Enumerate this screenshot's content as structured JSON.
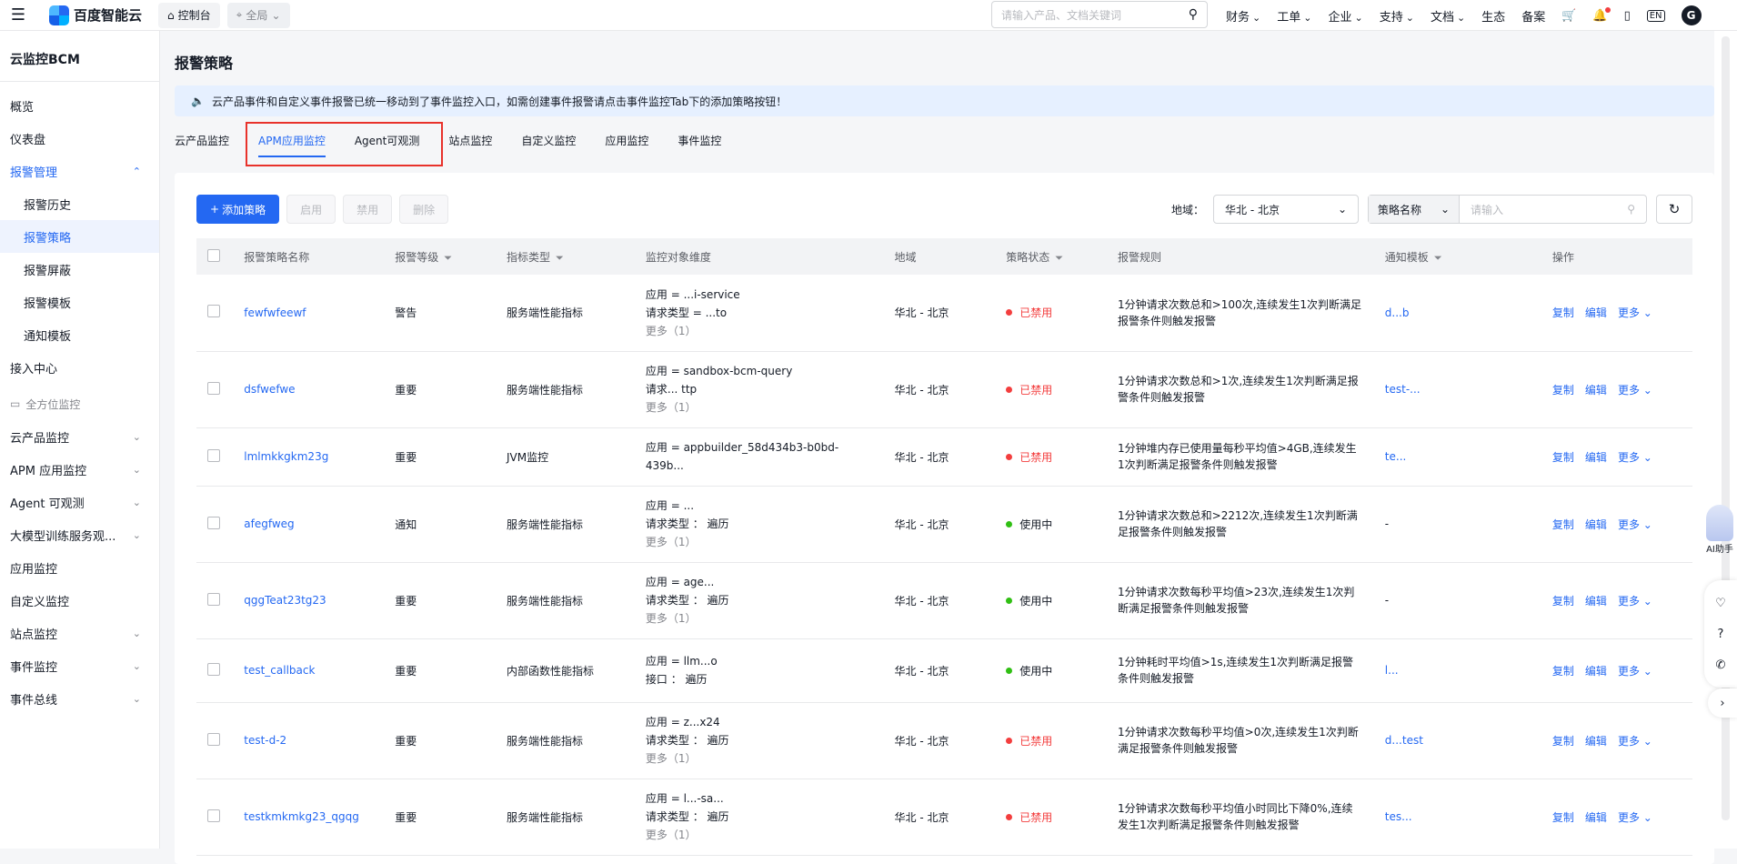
{
  "topbar": {
    "brand": "百度智能云",
    "console_label": "控制台",
    "region_label": "全局",
    "search_placeholder": "请输入产品、文档关键词",
    "nav": [
      "财务",
      "工单",
      "企业",
      "支持",
      "文档",
      "生态",
      "备案"
    ],
    "lang": "EN",
    "avatar_letter": "G"
  },
  "sidebar": {
    "title": "云监控BCM",
    "items_top": [
      "概览",
      "仪表盘"
    ],
    "alarm_group": "报警管理",
    "alarm_sub": [
      "报警历史",
      "报警策略",
      "报警屏蔽",
      "报警模板",
      "通知模板"
    ],
    "access_center": "接入中心",
    "section_label": "全方位监控",
    "items_bottom": [
      "云产品监控",
      "APM 应用监控",
      "Agent 可观测",
      "大模型训练服务观...",
      "应用监控",
      "自定义监控",
      "站点监控",
      "事件监控",
      "事件总线"
    ]
  },
  "main": {
    "title": "报警策略",
    "notice": "云产品事件和自定义事件报警已统一移动到了事件监控入口，如需创建事件报警请点击事件监控Tab下的添加策略按钮！",
    "tabs": [
      "云产品监控",
      "APM应用监控",
      "Agent可观测",
      "站点监控",
      "自定义监控",
      "应用监控",
      "事件监控"
    ],
    "toolbar": {
      "add": "添加策略",
      "enable": "启用",
      "disable": "禁用",
      "delete": "删除"
    },
    "filters": {
      "region_label": "地域：",
      "region_value": "华北 - 北京",
      "field_label": "策略名称",
      "input_placeholder": "请输入"
    }
  },
  "table": {
    "headers": [
      "报警策略名称",
      "报警等级",
      "指标类型",
      "监控对象维度",
      "地域",
      "策略状态",
      "报警规则",
      "通知模板",
      "操作"
    ],
    "ops": [
      "复制",
      "编辑",
      "更多"
    ],
    "rows": [
      {
        "name": "fewfwfeewf",
        "level": "警告",
        "type": "服务端性能指标",
        "dims": [
          "应用 = ...i-service",
          "请求类型 = ...to"
        ],
        "more": "更多（1）",
        "region": "华北 - 北京",
        "status": "已禁用",
        "status_color": "#f33e3e",
        "rule": "1分钟请求次数总和>100次,连续发生1次判断满足报警条件则触发报警",
        "template": "d...b"
      },
      {
        "name": "dsfwefwe",
        "level": "重要",
        "type": "服务端性能指标",
        "dims": [
          "应用 = sandbox-bcm-query",
          "请求... ttp"
        ],
        "more": "更多（1）",
        "region": "华北 - 北京",
        "status": "已禁用",
        "status_color": "#f33e3e",
        "rule": "1分钟请求次数总和>1次,连续发生1次判断满足报警条件则触发报警",
        "template": "test-..."
      },
      {
        "name": "lmlmkkgkm23g",
        "level": "重要",
        "type": "JVM监控",
        "dims": [
          "应用 = appbuilder_58d434b3-b0bd-439b..."
        ],
        "more": "",
        "region": "华北 - 北京",
        "status": "已禁用",
        "status_color": "#f33e3e",
        "rule": "1分钟堆内存已使用量每秒平均值>4GB,连续发生1次判断满足报警条件则触发报警",
        "template": "te..."
      },
      {
        "name": "afegfweg",
        "level": "通知",
        "type": "服务端性能指标",
        "dims": [
          "应用 = ...",
          "请求类型 ： 遍历"
        ],
        "more": "更多（1）",
        "region": "华北 - 北京",
        "status": "使用中",
        "status_color": "#30bf13",
        "rule": "1分钟请求次数总和>2212次,连续发生1次判断满足报警条件则触发报警",
        "template": "-"
      },
      {
        "name": "qggTeat23tg23",
        "level": "重要",
        "type": "服务端性能指标",
        "dims": [
          "应用 = age...",
          "请求类型 ： 遍历"
        ],
        "more": "更多（1）",
        "region": "华北 - 北京",
        "status": "使用中",
        "status_color": "#30bf13",
        "rule": "1分钟请求次数每秒平均值>23次,连续发生1次判断满足报警条件则触发报警",
        "template": "-"
      },
      {
        "name": "test_callback",
        "level": "重要",
        "type": "内部函数性能指标",
        "dims": [
          "应用 = llm...o",
          "接口 ： 遍历"
        ],
        "more": "",
        "region": "华北 - 北京",
        "status": "使用中",
        "status_color": "#30bf13",
        "rule": "1分钟耗时平均值>1s,连续发生1次判断满足报警条件则触发报警",
        "template": "l..."
      },
      {
        "name": "test-d-2",
        "level": "重要",
        "type": "服务端性能指标",
        "dims": [
          "应用 = z...x24",
          "请求类型 ： 遍历"
        ],
        "more": "更多（1）",
        "region": "华北 - 北京",
        "status": "已禁用",
        "status_color": "#f33e3e",
        "rule": "1分钟请求次数每秒平均值>0次,连续发生1次判断满足报警条件则触发报警",
        "template": "d...test"
      },
      {
        "name": "testkmkmkg23_qgqg",
        "level": "重要",
        "type": "服务端性能指标",
        "dims": [
          "应用 = l...-sa...",
          "请求类型 ： 遍历"
        ],
        "more": "更多（1）",
        "region": "华北 - 北京",
        "status": "已禁用",
        "status_color": "#f33e3e",
        "rule": "1分钟请求次数每秒平均值小时同比下降0%,连续发生1次判断满足报警条件则触发报警",
        "template": "tes..."
      }
    ]
  },
  "float": {
    "ai_label": "AI助手"
  }
}
